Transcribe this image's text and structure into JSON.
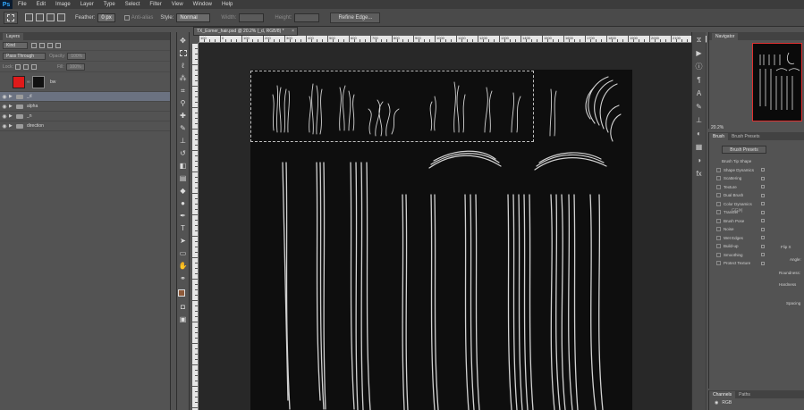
{
  "menubar": {
    "logo": "Ps",
    "items": [
      "File",
      "Edit",
      "Image",
      "Layer",
      "Type",
      "Select",
      "Filter",
      "View",
      "Window",
      "Help"
    ]
  },
  "options": {
    "feather_label": "Feather:",
    "feather_value": "0 px",
    "antialias_label": "Anti-alias",
    "style_label": "Style:",
    "style_value": "Normal",
    "width_label": "Width:",
    "height_label": "Height:",
    "refine_label": "Refine Edge..."
  },
  "layers_panel": {
    "tab": "Layers",
    "filter_kind": "Kind",
    "blend_mode": "Pass Through",
    "opacity_label": "Opacity:",
    "opacity_value": "100%",
    "lock_label": "Lock:",
    "fill_label": "Fill:",
    "fill_value": "100%",
    "layers": [
      {
        "name": "bw",
        "type": "adjustment",
        "selected": false
      },
      {
        "name": "_d",
        "type": "group",
        "selected": true
      },
      {
        "name": "alpha",
        "type": "group",
        "selected": false
      },
      {
        "name": "_n",
        "type": "group",
        "selected": false
      },
      {
        "name": "direction",
        "type": "group",
        "selected": false
      }
    ]
  },
  "document": {
    "tab_title": "TX_Eomer_hair.psd @ 20.2% (_d, RGB/8) *",
    "ruler_labels": [
      "100",
      "0",
      "100",
      "200",
      "300",
      "400",
      "500",
      "600",
      "700",
      "800",
      "900",
      "1000",
      "1100",
      "1200",
      "1300",
      "1400",
      "1500",
      "1600",
      "1700",
      "1800",
      "1900",
      "2000",
      "2100"
    ]
  },
  "navigator": {
    "tab": "Navigator",
    "zoom": "20.2%"
  },
  "brush_panel": {
    "tabs": [
      "Brush",
      "Brush Presets"
    ],
    "presets_button": "Brush Presets",
    "tip_shape": "Brush Tip Shape",
    "options": [
      "Shape Dynamics",
      "Scattering",
      "Texture",
      "Dual Brush",
      "Color Dynamics",
      "Transfer",
      "Brush Pose",
      "Noise",
      "Wet Edges",
      "Build-up",
      "Smoothing",
      "Protect Texture"
    ],
    "flip_label": "Flip X",
    "angle_label": "Angle:",
    "roundness_label": "Roundness:",
    "hardness_label": "Hardness",
    "spacing_label": "Spacing"
  },
  "channels_panel": {
    "tabs": [
      "Channels",
      "Paths"
    ],
    "row": "RGB"
  },
  "watermark": "CG网"
}
